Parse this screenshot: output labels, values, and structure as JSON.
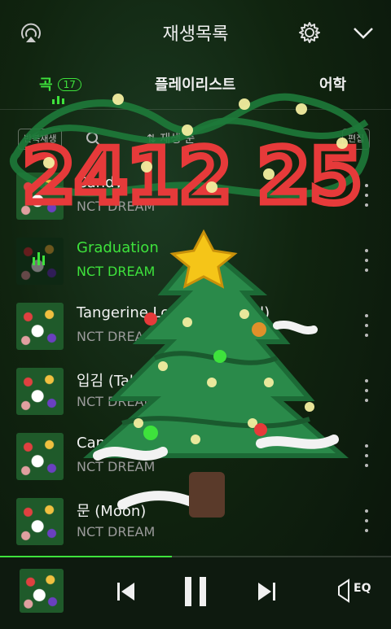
{
  "header": {
    "title": "재생목록"
  },
  "tabs": [
    {
      "label": "곡",
      "count": "17"
    },
    {
      "label": "플레이리스트"
    },
    {
      "label": "어학"
    }
  ],
  "toolbar": {
    "repeat_label": "반복재생",
    "sort_label": "재생 순",
    "edit_label": "편집"
  },
  "songs": [
    {
      "title": "Candy",
      "artist": "NCT DREAM"
    },
    {
      "title": "Graduation",
      "artist": "NCT DREAM"
    },
    {
      "title": "Tangerine Love (Seasonal)",
      "artist": "NCT DREAM"
    },
    {
      "title": "입김 (Take A Breath)",
      "artist": "NCT DREAM"
    },
    {
      "title": "Candle",
      "artist": "NCT DREAM"
    },
    {
      "title": "문 (Moon)",
      "artist": "NCT DREAM"
    }
  ],
  "player": {
    "eq_label": "EQ",
    "progress_fraction": 0.44
  },
  "doodle": {
    "text": "2412 25"
  },
  "colors": {
    "accent": "#3ee23c",
    "doodle_red": "#e63a3a",
    "tree_green": "#2a8a4a",
    "star": "#f5c518"
  }
}
